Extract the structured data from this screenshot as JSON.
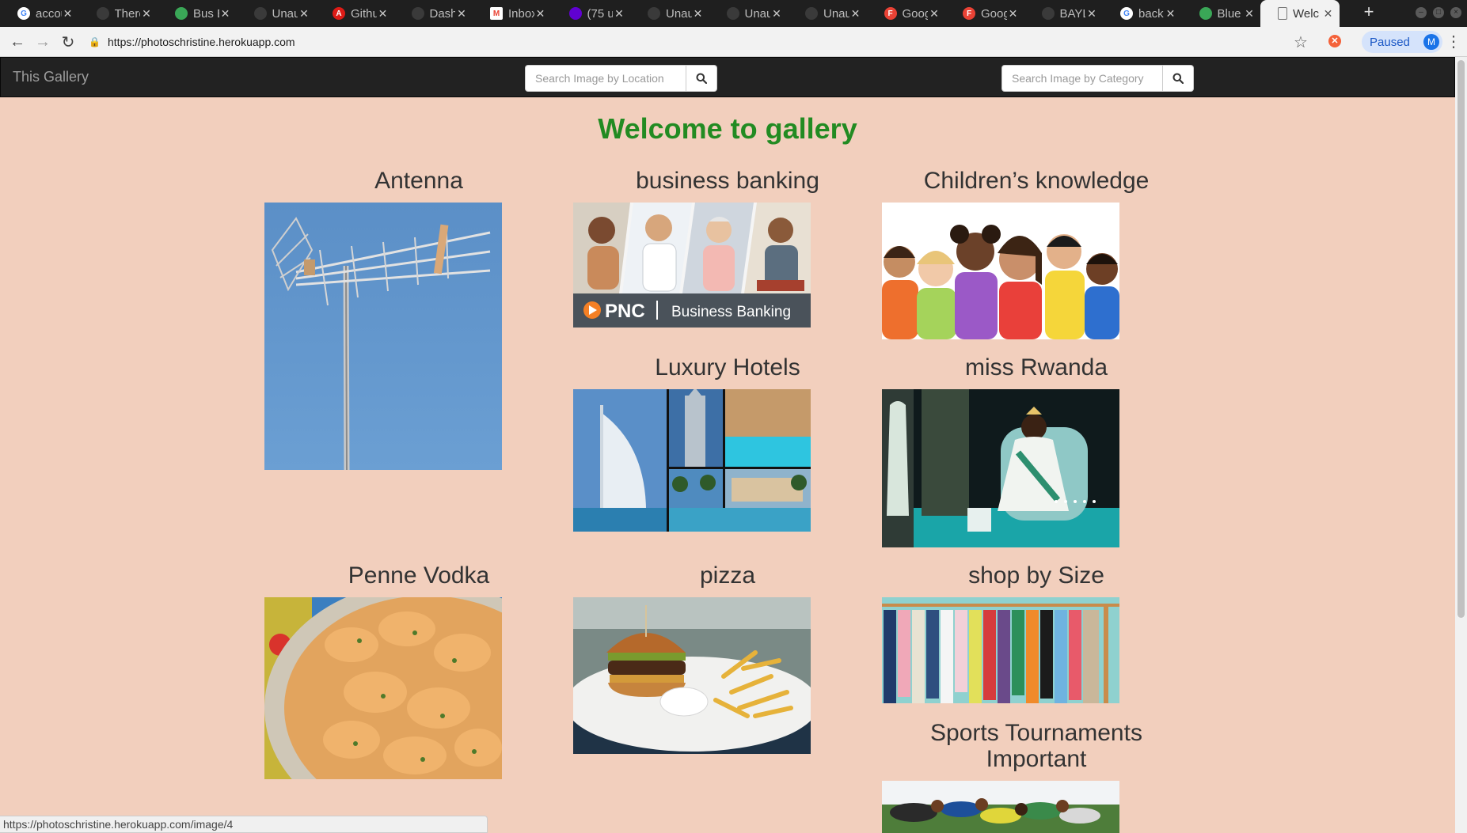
{
  "browser": {
    "tabs": [
      {
        "title": "accou",
        "icon": "google-icon",
        "color": "#ffffff"
      },
      {
        "title": "There",
        "icon": "document-icon",
        "color": "#3a3a3a"
      },
      {
        "title": "Bus E",
        "icon": "bus-icon",
        "color": "#3aa757"
      },
      {
        "title": "Unau",
        "icon": "blank-icon",
        "color": "#3a3a3a"
      },
      {
        "title": "Githu",
        "icon": "angular-icon",
        "color": "#dd1b16"
      },
      {
        "title": "Dash",
        "icon": "blank-icon",
        "color": "#3a3a3a"
      },
      {
        "title": "Inbox",
        "icon": "gmail-icon",
        "color": "#ea4335"
      },
      {
        "title": "(75 u",
        "icon": "yahoo-mail-icon",
        "color": "#6001d2"
      },
      {
        "title": "Unau",
        "icon": "blank-icon",
        "color": "#3a3a3a"
      },
      {
        "title": "Unau",
        "icon": "blank-icon",
        "color": "#3a3a3a"
      },
      {
        "title": "Unau",
        "icon": "blank-icon",
        "color": "#3a3a3a"
      },
      {
        "title": "Goog",
        "icon": "firebase-icon",
        "color": "#e94235"
      },
      {
        "title": "Goog",
        "icon": "firebase-icon",
        "color": "#e94235"
      },
      {
        "title": "BAYL",
        "icon": "document-icon",
        "color": "#3a3a3a"
      },
      {
        "title": "back",
        "icon": "google-icon",
        "color": "#ffffff"
      },
      {
        "title": "Blue",
        "icon": "bluehost-icon",
        "color": "#3aa757"
      },
      {
        "title": "Welc",
        "icon": "page-icon",
        "color": "#f2f2f2"
      }
    ],
    "active_tab": 16,
    "url": "https://photoschristine.herokuapp.com",
    "profile_status": "Paused",
    "profile_initial": "M",
    "status_url": "https://photoschristine.herokuapp.com/image/4"
  },
  "site": {
    "brand": "This Gallery",
    "location_search_placeholder": "Search Image by Location",
    "category_search_placeholder": "Search Image by Category",
    "welcome": "Welcome to gallery",
    "welcome_color": "#228b22",
    "background_color": "#f2cfbd"
  },
  "gallery": {
    "items": [
      {
        "title": "Antenna",
        "image": "antenna-photo"
      },
      {
        "title": "business banking",
        "image": "business-banking-photo",
        "caption": "PNC | Business Banking"
      },
      {
        "title": "Children’s knowledge",
        "image": "children-photo"
      },
      {
        "title": "Luxury Hotels",
        "image": "luxury-hotels-photo"
      },
      {
        "title": "miss Rwanda",
        "image": "miss-rwanda-photo"
      },
      {
        "title": "Penne Vodka",
        "image": "penne-vodka-photo"
      },
      {
        "title": "pizza",
        "image": "burger-photo"
      },
      {
        "title": "shop by Size",
        "image": "clothes-rack-photo"
      },
      {
        "title": "Sports Tournaments Important",
        "image": "sprinters-photo"
      }
    ]
  }
}
